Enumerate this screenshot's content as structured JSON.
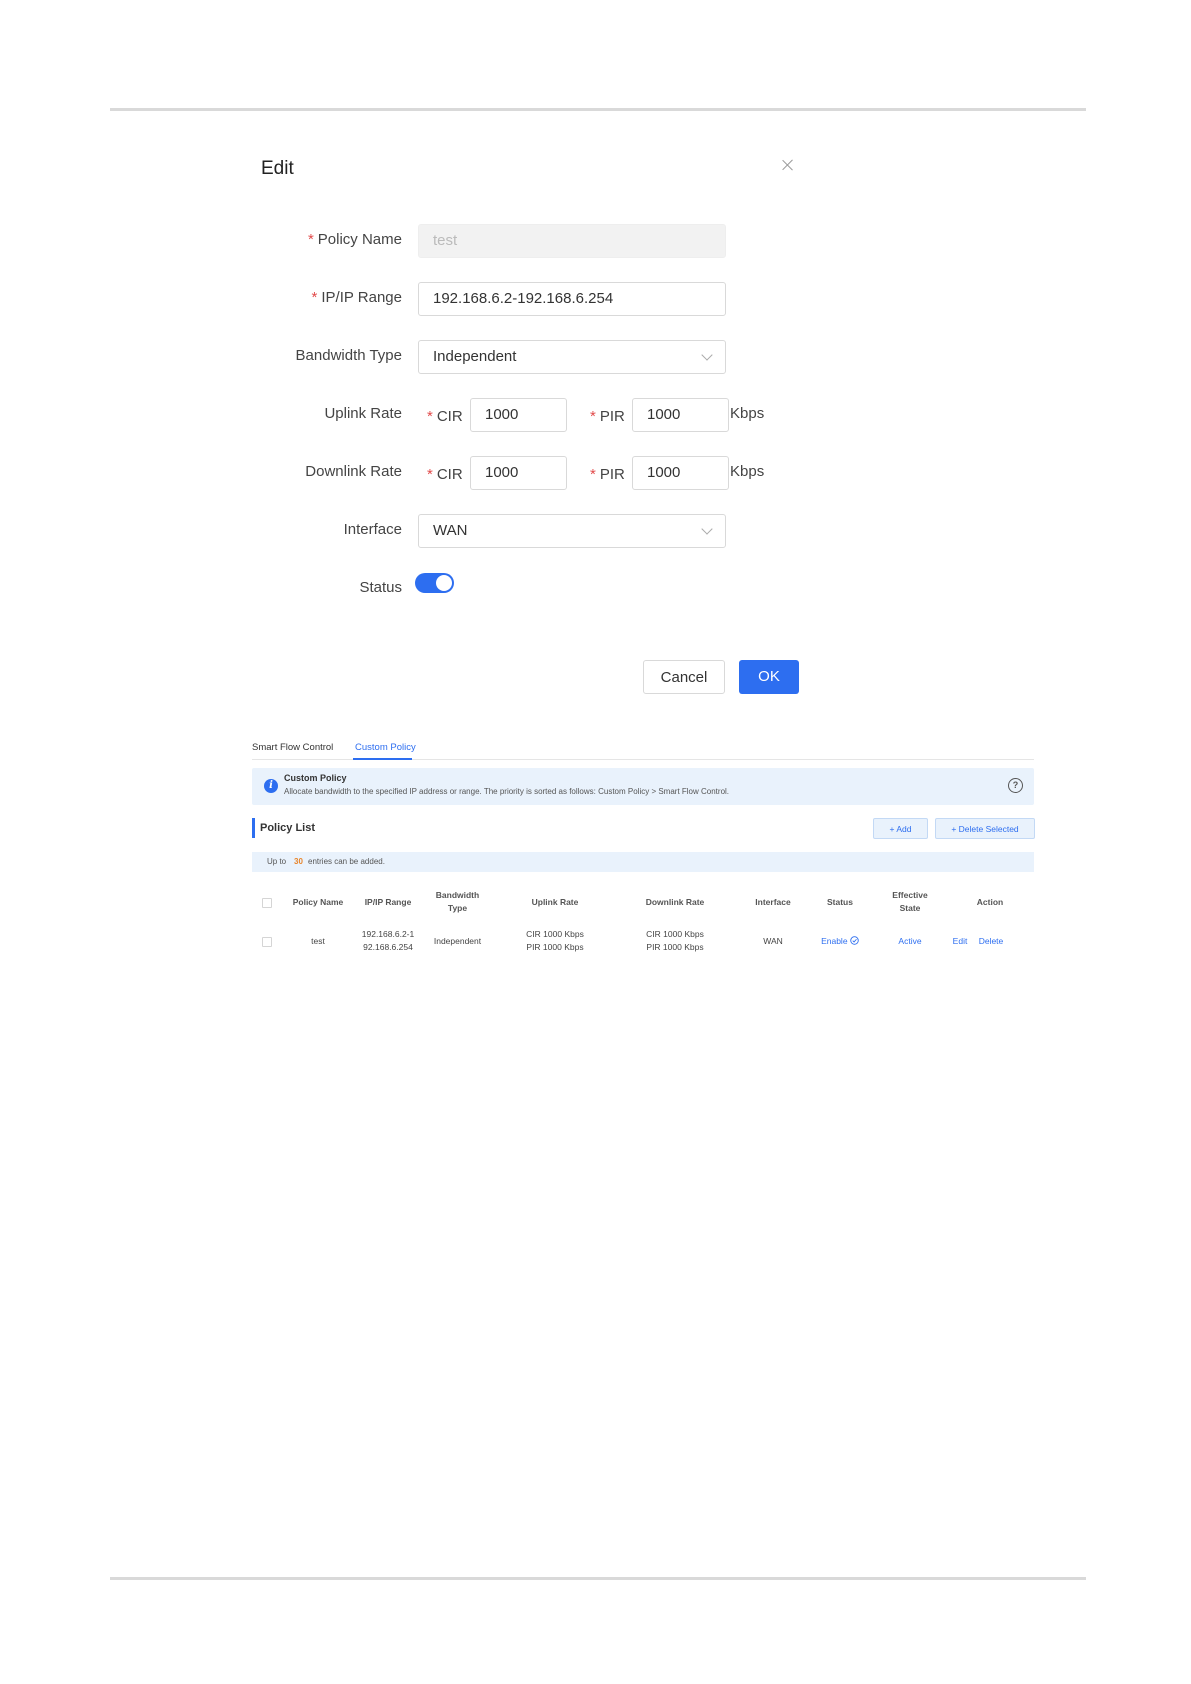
{
  "dialog": {
    "title": "Edit",
    "fields": {
      "policy_name": {
        "label": "Policy Name",
        "value": "test"
      },
      "ip_range": {
        "label": "IP/IP Range",
        "value": "192.168.6.2-192.168.6.254"
      },
      "bandwidth_type": {
        "label": "Bandwidth Type",
        "value": "Independent"
      },
      "uplink": {
        "label": "Uplink Rate",
        "cir_label": "CIR",
        "cir": "1000",
        "pir_label": "PIR",
        "pir": "1000",
        "unit": "Kbps"
      },
      "downlink": {
        "label": "Downlink Rate",
        "cir_label": "CIR",
        "cir": "1000",
        "pir_label": "PIR",
        "pir": "1000",
        "unit": "Kbps"
      },
      "interface": {
        "label": "Interface",
        "value": "WAN"
      },
      "status": {
        "label": "Status",
        "enabled": true
      }
    },
    "required_mark": "*",
    "cancel": "Cancel",
    "ok": "OK"
  },
  "page": {
    "tabs": [
      "Smart Flow Control",
      "Custom Policy"
    ],
    "active_tab": "Custom Policy",
    "info": {
      "title": "Custom Policy",
      "text": "Allocate bandwidth to the specified IP address or range. The priority is sorted as follows: Custom Policy > Smart Flow Control.",
      "icon_glyph": "i",
      "help_glyph": "?"
    },
    "policy_list": {
      "title": "Policy List",
      "add": "+ Add",
      "delete_selected": "+ Delete Selected",
      "limit_prefix": "Up to",
      "limit_num": "30",
      "limit_suffix": "entries can be added."
    },
    "table": {
      "headers": {
        "policy_name": "Policy Name",
        "ip_range": "IP/IP Range",
        "bw_type_1": "Bandwidth",
        "bw_type_2": "Type",
        "uplink": "Uplink Rate",
        "downlink": "Downlink Rate",
        "interface": "Interface",
        "status": "Status",
        "eff_1": "Effective",
        "eff_2": "State",
        "action": "Action"
      },
      "rows": [
        {
          "policy_name": "test",
          "ip_1": "192.168.6.2-1",
          "ip_2": "92.168.6.254",
          "bw_type": "Independent",
          "uplink_1": "CIR 1000 Kbps",
          "uplink_2": "PIR 1000 Kbps",
          "downlink_1": "CIR 1000 Kbps",
          "downlink_2": "PIR 1000 Kbps",
          "interface": "WAN",
          "status": "Enable",
          "status_icon": "check-circle",
          "effective_state": "Active",
          "edit": "Edit",
          "delete": "Delete"
        }
      ]
    }
  },
  "colors": {
    "accent": "#2d6ef0",
    "required": "#e24b4b",
    "info_bg": "#e9f2fc",
    "limit_num": "#e8852b"
  }
}
